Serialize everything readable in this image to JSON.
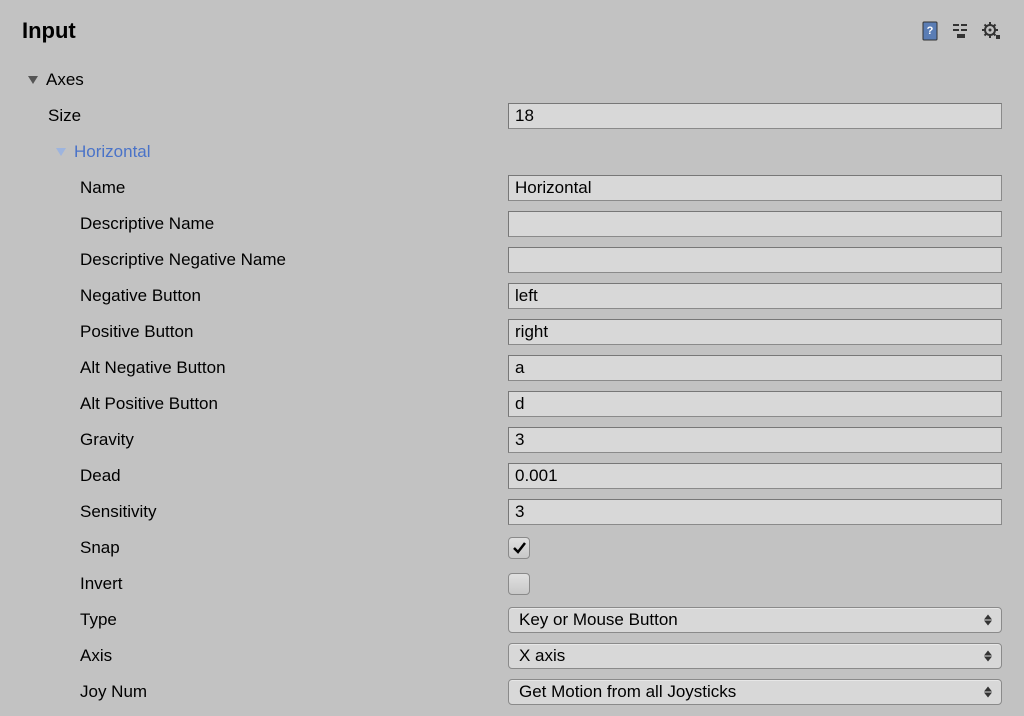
{
  "panel": {
    "title": "Input",
    "icons": {
      "help": "help-icon",
      "preset": "preset-icon",
      "gear": "gear-icon"
    }
  },
  "axes": {
    "label": "Axes",
    "size_label": "Size",
    "size_value": "18"
  },
  "axis0": {
    "header": "Horizontal",
    "fields": {
      "name": {
        "label": "Name",
        "value": "Horizontal"
      },
      "descriptive_name": {
        "label": "Descriptive Name",
        "value": ""
      },
      "descriptive_negative_name": {
        "label": "Descriptive Negative Name",
        "value": ""
      },
      "negative_button": {
        "label": "Negative Button",
        "value": "left"
      },
      "positive_button": {
        "label": "Positive Button",
        "value": "right"
      },
      "alt_negative_button": {
        "label": "Alt Negative Button",
        "value": "a"
      },
      "alt_positive_button": {
        "label": "Alt Positive Button",
        "value": "d"
      },
      "gravity": {
        "label": "Gravity",
        "value": "3"
      },
      "dead": {
        "label": "Dead",
        "value": "0.001"
      },
      "sensitivity": {
        "label": "Sensitivity",
        "value": "3"
      },
      "snap": {
        "label": "Snap",
        "value": true
      },
      "invert": {
        "label": "Invert",
        "value": false
      },
      "type": {
        "label": "Type",
        "value": "Key or Mouse Button"
      },
      "axis": {
        "label": "Axis",
        "value": "X axis"
      },
      "joy_num": {
        "label": "Joy Num",
        "value": "Get Motion from all Joysticks"
      }
    }
  }
}
